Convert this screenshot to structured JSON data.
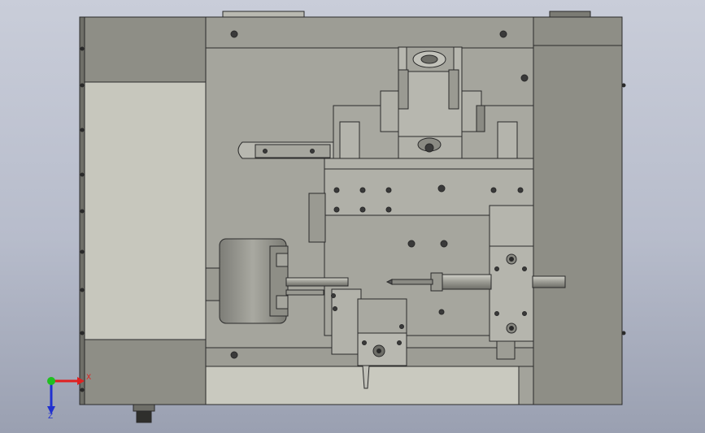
{
  "scene": {
    "description_visible_text": "",
    "colors": {
      "background_top": "#c9cdd9",
      "background_bottom": "#9aa0b1",
      "casing_dark": "#8e8e86",
      "casing_light": "#c7c7bd",
      "plate": "#a5a59d",
      "line": "#2a2a2a",
      "axis_x": "#e02020",
      "axis_y": "#20c020",
      "axis_z": "#2030d0"
    }
  },
  "triad": {
    "x_label": "X",
    "z_label": "Z"
  }
}
